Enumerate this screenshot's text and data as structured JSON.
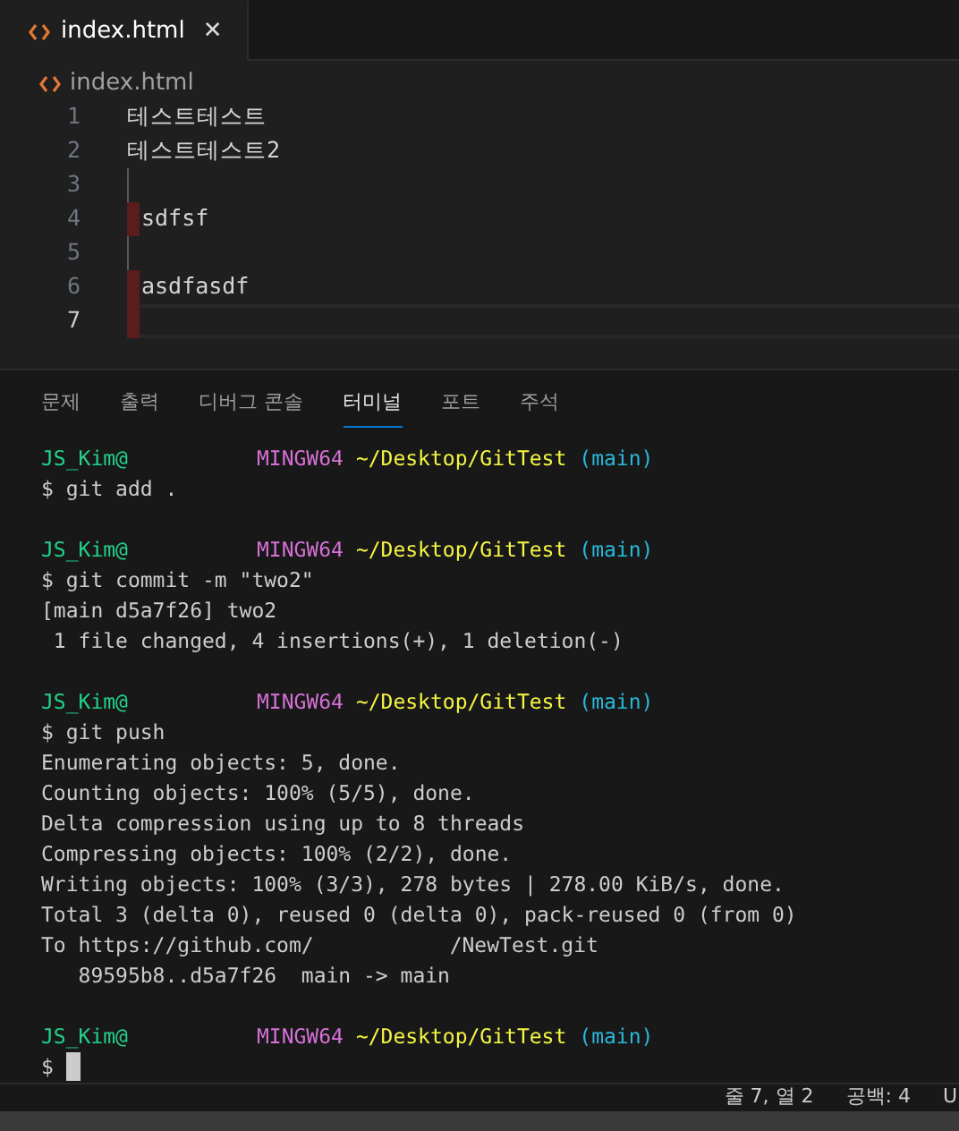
{
  "editor_tabs": [
    {
      "label": "index.html",
      "selected": true,
      "close": "✕"
    }
  ],
  "breadcrumb": "index.html",
  "lines": [
    {
      "number": "1",
      "text": "테스트테스트",
      "changed": false,
      "current": false
    },
    {
      "number": "2",
      "text": "테스트테스트2",
      "changed": false,
      "current": false
    },
    {
      "number": "3",
      "changed": false,
      "current": false
    },
    {
      "number": "4",
      "text": "sdfsf",
      "changed": true,
      "current": false
    },
    {
      "number": "5",
      "changed": false,
      "current": false
    },
    {
      "number": "6",
      "text": "asdfasdf",
      "changed": true,
      "current": false
    },
    {
      "number": "7",
      "changed": true,
      "current": true
    }
  ],
  "panel_tabs": [
    {
      "label": "문제",
      "selected": false
    },
    {
      "label": "출력",
      "selected": false
    },
    {
      "label": "디버그 콘솔",
      "selected": false
    },
    {
      "label": "터미널",
      "selected": true
    },
    {
      "label": "포트",
      "selected": false
    },
    {
      "label": "주석",
      "selected": false
    }
  ],
  "terminal": [
    {
      "kind": "prompt",
      "user": "JS_Kim@",
      "system": "MINGW64",
      "path": "~/Desktop/GitTest",
      "branch": "(main)"
    },
    {
      "kind": "output",
      "text": "$ git add ."
    },
    {
      "kind": "blank"
    },
    {
      "kind": "prompt",
      "user": "JS_Kim@",
      "system": "MINGW64",
      "path": "~/Desktop/GitTest",
      "branch": "(main)"
    },
    {
      "kind": "output",
      "text": "$ git commit -m \"two2\""
    },
    {
      "kind": "output",
      "text": "[main d5a7f26] two2"
    },
    {
      "kind": "output",
      "text": " 1 file changed, 4 insertions(+), 1 deletion(-)"
    },
    {
      "kind": "blank"
    },
    {
      "kind": "prompt",
      "user": "JS_Kim@",
      "system": "MINGW64",
      "path": "~/Desktop/GitTest",
      "branch": "(main)"
    },
    {
      "kind": "output",
      "text": "$ git push"
    },
    {
      "kind": "output",
      "text": "Enumerating objects: 5, done."
    },
    {
      "kind": "output",
      "text": "Counting objects: 100% (5/5), done."
    },
    {
      "kind": "output",
      "text": "Delta compression using up to 8 threads"
    },
    {
      "kind": "output",
      "text": "Compressing objects: 100% (2/2), done."
    },
    {
      "kind": "output",
      "text": "Writing objects: 100% (3/3), 278 bytes | 278.00 KiB/s, done."
    },
    {
      "kind": "output",
      "text": "Total 3 (delta 0), reused 0 (delta 0), pack-reused 0 (from 0)"
    },
    {
      "kind": "split",
      "text": "To https://github.com/",
      "rest": "/NewTest.git"
    },
    {
      "kind": "output",
      "text": "   89595b8..d5a7f26  main -> main"
    },
    {
      "kind": "blank"
    },
    {
      "kind": "prompt",
      "user": "JS_Kim@",
      "system": "MINGW64",
      "path": "~/Desktop/GitTest",
      "branch": "(main)"
    },
    {
      "kind": "input",
      "text": "$"
    }
  ],
  "status_bar": [
    "줄 7, 열 2",
    "공백: 4",
    "U"
  ]
}
